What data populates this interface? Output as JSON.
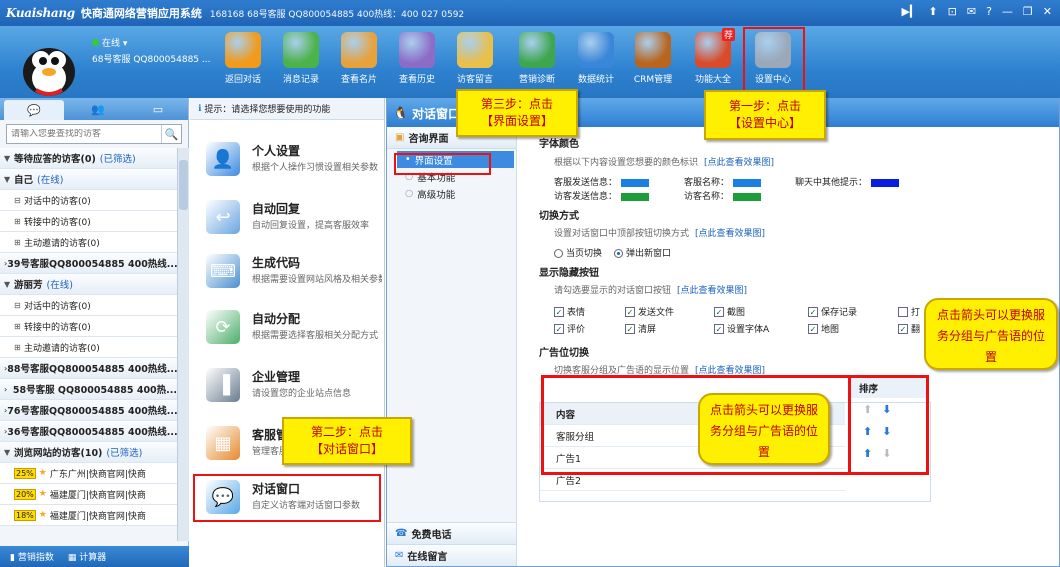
{
  "titlebar": {
    "brand": "Kuaishang",
    "app_title": "快商通网络营销应用系统",
    "info": "168168 68号客服 QQ800054885   400热线：400 027 0592",
    "controls": [
      "▶▎",
      "⬆",
      "⊡",
      "✉",
      "?",
      "—",
      "❐",
      "✕"
    ]
  },
  "user": {
    "status": "在线",
    "name": "68号客服 QQ800054885 ..."
  },
  "toolbar": {
    "items": [
      {
        "label": "返回对话",
        "icon": "back-arrow-icon",
        "color": "#f29a1a"
      },
      {
        "label": "消息记录",
        "icon": "message-icon",
        "color": "#4cb24a"
      },
      {
        "label": "查看名片",
        "icon": "card-icon",
        "color": "#e8a23c"
      },
      {
        "label": "查看历史",
        "icon": "history-icon",
        "color": "#8c6cc6"
      },
      {
        "label": "访客留言",
        "icon": "note-icon",
        "color": "#e8c04a"
      },
      {
        "label": "营销诊断",
        "icon": "diagnose-icon",
        "color": "#3ea64e"
      },
      {
        "label": "数据统计",
        "icon": "stats-icon",
        "color": "#3a86d8"
      },
      {
        "label": "CRM管理",
        "icon": "crm-icon",
        "color": "#b8651f"
      },
      {
        "label": "功能大全",
        "icon": "tools-icon",
        "color": "#d94b2a",
        "badge": "荐"
      },
      {
        "label": "设置中心",
        "icon": "gear-icon",
        "color": "#9aa8b8"
      }
    ]
  },
  "left": {
    "search_placeholder": "请输入您要查找的访客",
    "rows": [
      {
        "type": "group",
        "arrow": "▼",
        "text": "等待应答的访客(0)",
        "tag": "(已筛选)"
      },
      {
        "type": "group",
        "arrow": "▼",
        "text": "自己",
        "tag": "(在线)"
      },
      {
        "type": "sub",
        "arrow": "⊟",
        "text": "对话中的访客(0)"
      },
      {
        "type": "sub",
        "arrow": "⊞",
        "text": "转接中的访客(0)"
      },
      {
        "type": "sub",
        "arrow": "⊞",
        "text": "主动邀请的访客(0)"
      },
      {
        "type": "group",
        "arrow": "›",
        "text": "39号客服QQ800054885  400热线..."
      },
      {
        "type": "group",
        "arrow": "▼",
        "text": "游丽芳",
        "tag": "(在线)"
      },
      {
        "type": "sub",
        "arrow": "⊟",
        "text": "对话中的访客(0)"
      },
      {
        "type": "sub",
        "arrow": "⊞",
        "text": "转接中的访客(0)"
      },
      {
        "type": "sub",
        "arrow": "⊞",
        "text": "主动邀请的访客(0)"
      },
      {
        "type": "group",
        "arrow": "›",
        "text": "88号客服QQ800054885  400热线..."
      },
      {
        "type": "group",
        "arrow": "›",
        "text": "58号客服 QQ800054885  400热..."
      },
      {
        "type": "group",
        "arrow": "›",
        "text": "76号客服QQ800054885  400热线..."
      },
      {
        "type": "group",
        "arrow": "›",
        "text": "36号客服QQ800054885  400热线..."
      },
      {
        "type": "group",
        "arrow": "▼",
        "text": "浏览网站的访客(10)",
        "tag": "(已筛选)"
      },
      {
        "type": "visitor",
        "pct": "25%",
        "text": "广东广州|快商官网|快商"
      },
      {
        "type": "visitor",
        "pct": "20%",
        "text": "福建厦门|快商官网|快商"
      },
      {
        "type": "visitor",
        "pct": "18%",
        "text": "福建厦门|快商官网|快商"
      }
    ],
    "footer": {
      "a": "营销指数",
      "b": "计算器"
    }
  },
  "middle": {
    "hint": "提示：请选择您想要使用的功能",
    "items": [
      {
        "title": "个人设置",
        "desc": "根据个人操作习惯设置相关参数",
        "color": "#3d8be0"
      },
      {
        "title": "自动回复",
        "desc": "自动回复设置，提高客服效率",
        "color": "#6aa5e0"
      },
      {
        "title": "生成代码",
        "desc": "根据需要设置网站风格及相关参数",
        "color": "#4a8fd0"
      },
      {
        "title": "自动分配",
        "desc": "根据需要选择客服相关分配方式",
        "color": "#4cae6a"
      },
      {
        "title": "企业管理",
        "desc": "请设置您的企业站点信息",
        "color": "#6a7c90"
      },
      {
        "title": "客服管理",
        "desc": "管理客服",
        "color": "#e58a2c"
      },
      {
        "title": "对话窗口",
        "desc": "自定义访客端对话窗口参数",
        "color": "#58a8e8"
      }
    ]
  },
  "dialog": {
    "title": "对话窗口",
    "nav": {
      "section": "咨询界面",
      "items": [
        "界面设置",
        "基本功能",
        "高级功能"
      ],
      "bottom1": "免费电话",
      "bottom2": "在线留言"
    },
    "colors": {
      "title": "字体颜色",
      "desc": "根据以下内容设置您想要的颜色标识",
      "link": "[点此查看效果图]",
      "labels": {
        "service_send": "客服发送信息：",
        "visitor_send": "访客发送信息：",
        "service_name": "客服名称：",
        "visitor_name": "访客名称：",
        "chat_prompt": "聊天中其他提示："
      },
      "swatches": {
        "service_send": "#1a7fe0",
        "visitor_send": "#1a9e3a",
        "service_name": "#1a7fe0",
        "visitor_name": "#1a9e3a",
        "chat_prompt": "#0a1ee0"
      }
    },
    "switch": {
      "title": "切换方式",
      "desc": "设置对话窗口中顶部按钮切换方式",
      "link": "[点此查看效果图]",
      "opt1": "当页切换",
      "opt2": "弹出新窗口"
    },
    "buttons": {
      "title": "显示隐藏按钮",
      "desc": "请勾选要显示的对话窗口按钮",
      "link": "[点此查看效果图]",
      "items": [
        "表情",
        "发送文件",
        "截图",
        "保存记录",
        "打",
        "评价",
        "清屏",
        "设置字体A",
        "地图",
        "翻"
      ]
    },
    "ads": {
      "title": "广告位切换",
      "desc": "切换客服分组及广告语的显示位置",
      "link": "[点此查看效果图]",
      "col_content": "内容",
      "col_sort": "排序",
      "rows": [
        "客服分组",
        "广告1",
        "广告2"
      ]
    }
  },
  "callouts": {
    "step1": {
      "line1": "第一步：点击",
      "line2": "【设置中心】"
    },
    "step2": {
      "line1": "第二步：点击",
      "line2": "【对话窗口】"
    },
    "step3": {
      "line1": "第三步：点击",
      "line2": "【界面设置】"
    },
    "arrow1": "点击箭头可以更换服务分组与广告语的位置",
    "arrow2": "点击箭头可以更换服务分组与广告语的位置"
  }
}
